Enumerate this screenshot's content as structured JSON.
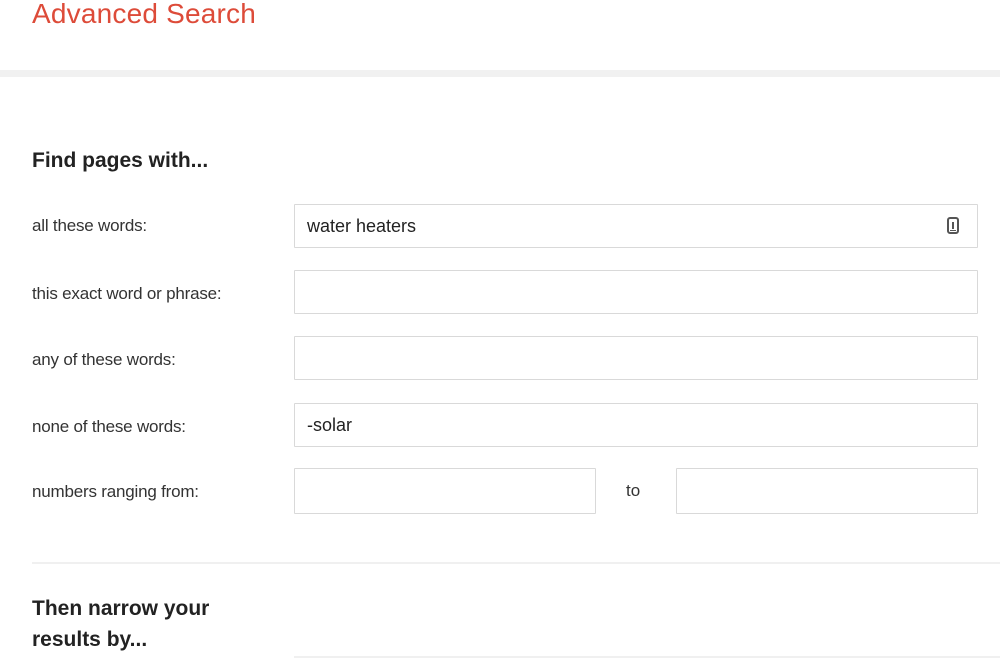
{
  "header": {
    "title": "Advanced Search"
  },
  "find_section": {
    "heading": "Find pages with...",
    "rows": [
      {
        "label": "all these words:",
        "value": "water heaters",
        "icon": "keyboard-icon"
      },
      {
        "label": "this exact word or phrase:",
        "value": ""
      },
      {
        "label": "any of these words:",
        "value": ""
      },
      {
        "label": "none of these words:",
        "value": "-solar"
      }
    ],
    "range": {
      "label": "numbers ranging from:",
      "from_value": "",
      "separator": "to",
      "to_value": ""
    }
  },
  "narrow_section": {
    "heading": "Then narrow your results by..."
  },
  "colors": {
    "title": "#dd4b39",
    "field_border": "#d9d9d9",
    "divider": "#f1f1f1"
  }
}
